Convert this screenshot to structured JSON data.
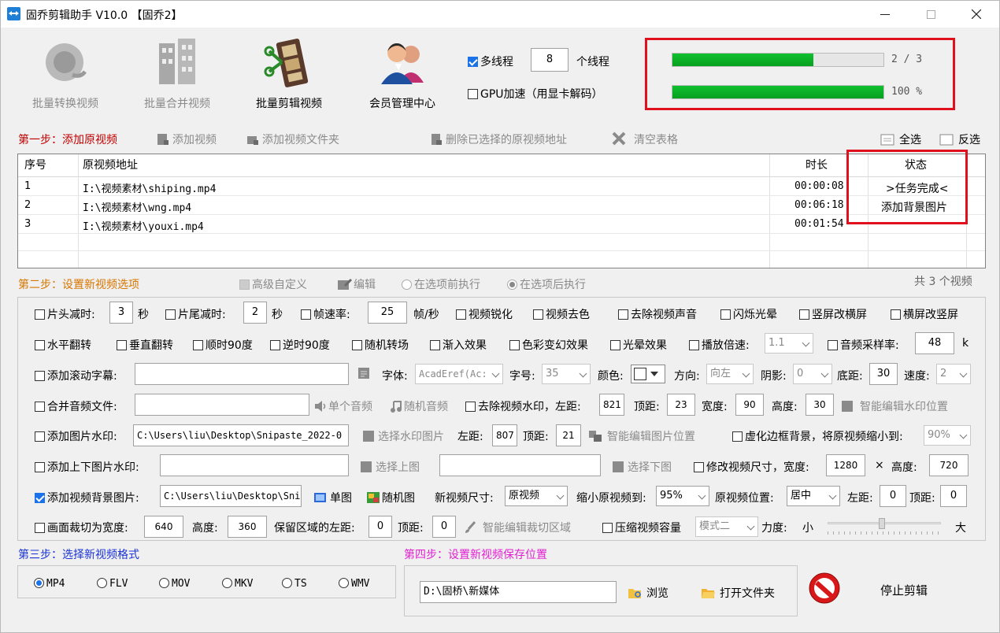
{
  "window": {
    "title": "固乔剪辑助手 V10.0 【固乔2】"
  },
  "tools": [
    {
      "label": "批量转换视频",
      "enabled": false
    },
    {
      "label": "批量合并视频",
      "enabled": false
    },
    {
      "label": "批量剪辑视频",
      "enabled": true
    },
    {
      "label": "会员管理中心",
      "enabled": true
    }
  ],
  "threads": {
    "multithread_label": "多线程",
    "count": "8",
    "unit": "个线程",
    "multithread_checked": true,
    "gpu_label": "GPU加速（用显卡解码）",
    "gpu_checked": false
  },
  "progress": {
    "file_text": "2 / 3",
    "file_fraction": 0.667,
    "total_text": "100 %",
    "total_fraction": 1.0
  },
  "step1": {
    "title": "第一步：添加原视频",
    "add_video": "添加视频",
    "add_folder": "添加视频文件夹",
    "delete_selected": "删除已选择的原视频地址",
    "clear_table": "清空表格",
    "select_all": "全选",
    "invert_select": "反选"
  },
  "table": {
    "headers": [
      "序号",
      "原视频地址",
      "时长",
      "状态"
    ],
    "rows": [
      {
        "index": "1",
        "path": "I:\\视频素材\\shiping.mp4",
        "duration": "00:00:08",
        "status": ">任务完成<"
      },
      {
        "index": "2",
        "path": "I:\\视频素材\\wng.mp4",
        "duration": "00:06:18",
        "status": "添加背景图片"
      },
      {
        "index": "3",
        "path": "I:\\视频素材\\youxi.mp4",
        "duration": "00:01:54",
        "status": ""
      }
    ]
  },
  "step2": {
    "title": "第二步：设置新视频选项",
    "advanced": "高级自定义",
    "edit": "编辑",
    "before": "在选项前执行",
    "after": "在选项后执行",
    "count_text": "共 3 个视频"
  },
  "opts": {
    "head_cut": "片头减时:",
    "head_val": "3",
    "sec": "秒",
    "tail_cut": "片尾减时:",
    "tail_val": "2",
    "fps": "帧速率:",
    "fps_val": "25",
    "fps_unit": "帧/秒",
    "sharpen": "视频锐化",
    "decolor": "视频去色",
    "remove_audio": "去除视频声音",
    "flash": "闪烁光晕",
    "v2h": "竖屏改横屏",
    "h2v": "横屏改竖屏",
    "hflip": "水平翻转",
    "vflip": "垂直翻转",
    "cw90": "顺时90度",
    "ccw90": "逆时90度",
    "rand_trans": "随机转场",
    "fade": "渐入效果",
    "color_fx": "色彩变幻效果",
    "glow": "光晕效果",
    "speed": "播放倍速:",
    "speed_val": "1.1",
    "sample": "音频采样率:",
    "sample_val": "48",
    "sample_unit": "k",
    "scroll_text": "添加滚动字幕:",
    "font": "字体:",
    "font_val": "AcadEref(Ac:",
    "fontsize": "字号:",
    "fontsize_val": "35",
    "color": "颜色:",
    "direction": "方向:",
    "direction_val": "向左",
    "shadow": "阴影:",
    "shadow_val": "0",
    "bottom": "底距:",
    "bottom_val": "30",
    "rate": "速度:",
    "rate_val": "2",
    "merge_audio": "合并音频文件:",
    "single_audio": "单个音频",
    "random_audio": "随机音频",
    "remove_wm": "去除视频水印，左距:",
    "wm_left": "821",
    "top_label": "顶距:",
    "wm_top": "23",
    "width_label": "宽度:",
    "wm_width": "90",
    "height_label": "高度:",
    "wm_height": "30",
    "smart_wm": "智能编辑水印位置",
    "img_wm": "添加图片水印:",
    "img_wm_path": "C:\\Users\\liu\\Desktop\\Snipaste_2022-0",
    "choose_wm": "选择水印图片",
    "left_label": "左距:",
    "img_left": "807",
    "img_top": "21",
    "smart_img": "智能编辑图片位置",
    "blur_bg": "虚化边框背景，将原视频缩小到:",
    "blur_val": "90%",
    "tb_wm": "添加上下图片水印:",
    "choose_top": "选择上图",
    "choose_bottom": "选择下图",
    "resize": "修改视频尺寸，宽度:",
    "resize_w": "1280",
    "times": "×",
    "height2": "高度:",
    "resize_h": "720",
    "bg_img": "添加视频背景图片:",
    "bg_path": "C:\\Users\\liu\\Desktop\\Sni",
    "single_img": "单图",
    "random_img": "随机图",
    "new_size": "新视频尺寸:",
    "new_size_val": "原视频",
    "shrink": "缩小原视频到:",
    "shrink_val": "95%",
    "orig_pos": "原视频位置:",
    "orig_pos_val": "居中",
    "bg_left": "0",
    "bg_top": "0",
    "crop": "画面裁切为宽度:",
    "crop_w": "640",
    "crop_h_label": "高度:",
    "crop_h": "360",
    "keep_left": "保留区域的左距:",
    "crop_left": "0",
    "crop_top": "0",
    "smart_crop": "智能编辑裁切区域",
    "compress": "压缩视频容量",
    "compress_mode": "模式二",
    "strength": "力度:",
    "small": "小",
    "large": "大"
  },
  "step3": {
    "title": "第三步：选择新视频格式",
    "formats": [
      "MP4",
      "FLV",
      "MOV",
      "MKV",
      "TS",
      "WMV"
    ],
    "selected": "MP4"
  },
  "step4": {
    "title": "第四步：设置新视频保存位置",
    "path": "D:\\固桥\\新媒体",
    "browse": "浏览",
    "open_folder": "打开文件夹"
  },
  "stop": {
    "label": "停止剪辑"
  },
  "colors": {
    "accent": "#1a73e8",
    "progress_green": "#0fb82a",
    "highlight_red": "#e0101c",
    "step_red": "#c00000",
    "step_orange": "#d77600",
    "step_blue": "#1b33d4",
    "step_magenta": "#e020d0"
  }
}
